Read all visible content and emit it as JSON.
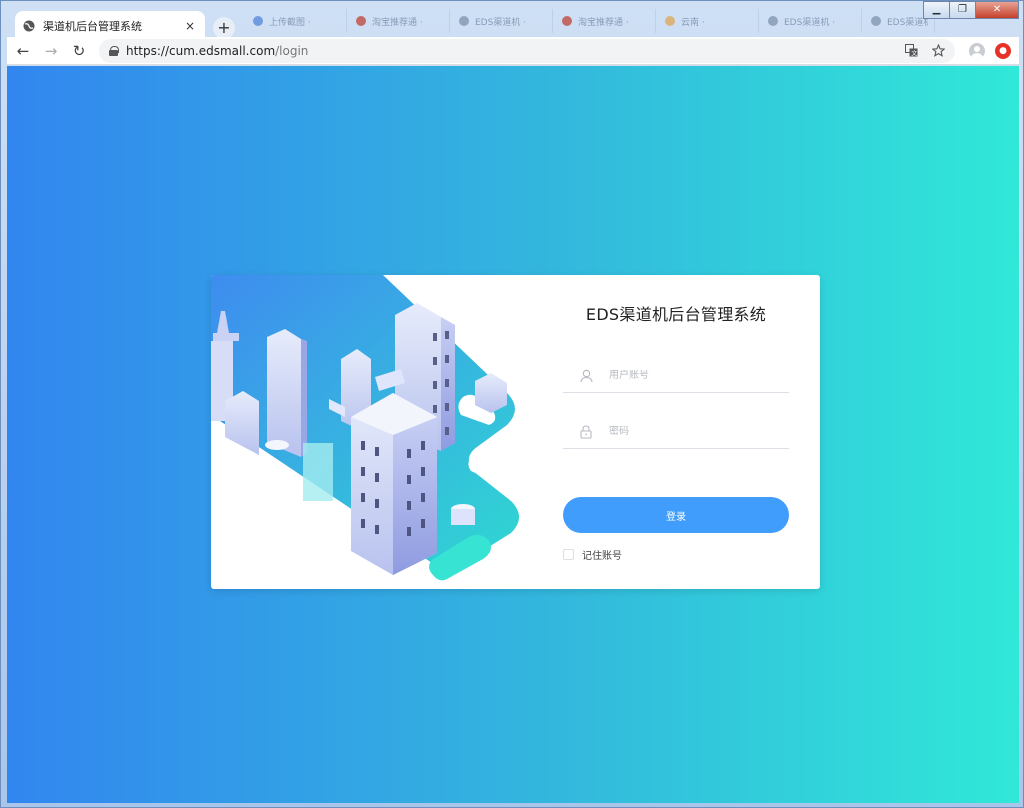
{
  "browser": {
    "active_tab": {
      "title": "渠道机后台管理系统",
      "close": "×"
    },
    "new_tab": "+",
    "background_tabs": [
      {
        "title": "上传截图 ·",
        "color": "#4a7fd8"
      },
      {
        "title": "淘宝推荐通 ·",
        "color": "#c0392b"
      },
      {
        "title": "EDS渠道机 ·",
        "color": "#7a8da8"
      },
      {
        "title": "淘宝推荐通 ·",
        "color": "#c0392b"
      },
      {
        "title": "云南 ·",
        "color": "#e0a34a"
      },
      {
        "title": "EDS渠道机 ·",
        "color": "#7a8da8"
      },
      {
        "title": "EDS渠道机 ·",
        "color": "#7a8da8"
      }
    ],
    "window_controls": {
      "minimize": "▁",
      "restore": "❐",
      "close": "✕"
    },
    "nav": {
      "back": "←",
      "forward": "→",
      "reload": "↻"
    },
    "url": {
      "scheme_host": "https://cum.edsmall.com",
      "path": "/login"
    },
    "omni_icons": {
      "translate": "⌘",
      "star": "☆"
    },
    "ext_badge": "●"
  },
  "login": {
    "title": "EDS渠道机后台管理系统",
    "username_placeholder": "用户账号",
    "password_placeholder": "密码",
    "submit_label": "登录",
    "remember_label": "记住账号"
  },
  "colors": {
    "gradient_start": "#3286ef",
    "gradient_end": "#30e8d8",
    "button": "#409dfc"
  }
}
